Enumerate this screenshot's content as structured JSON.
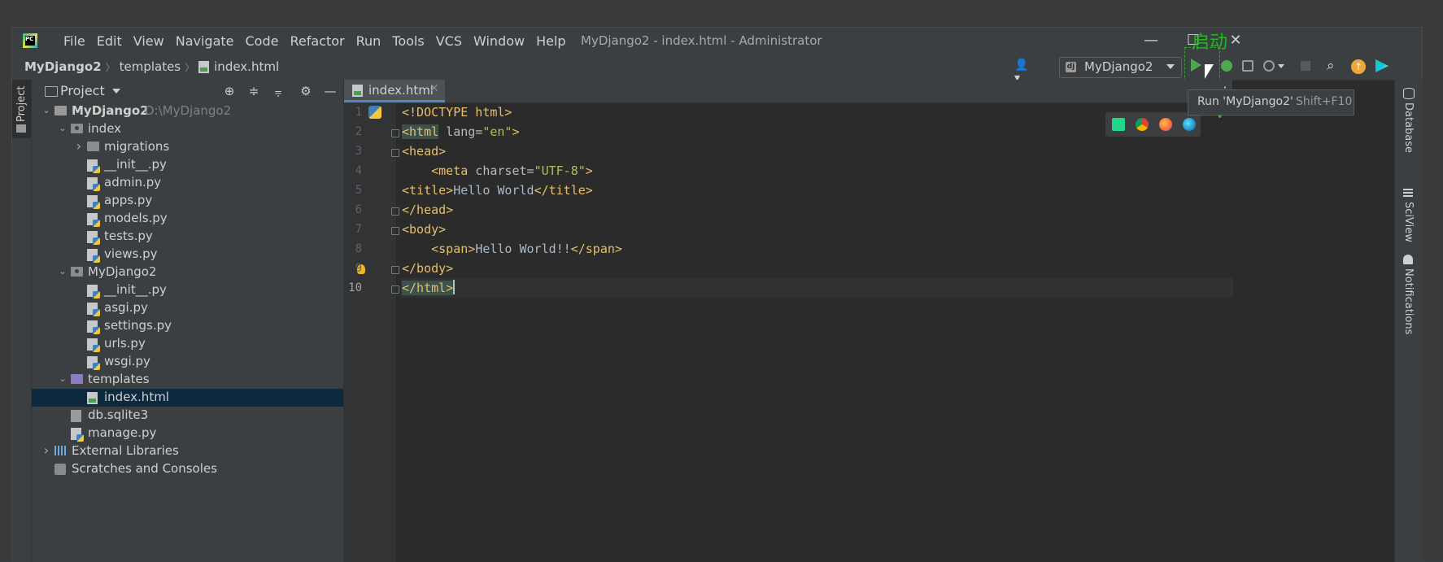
{
  "window": {
    "title": "MyDjango2 - index.html - Administrator",
    "annotation": "启动"
  },
  "menu": [
    "File",
    "Edit",
    "View",
    "Navigate",
    "Code",
    "Refactor",
    "Run",
    "Tools",
    "VCS",
    "Window",
    "Help"
  ],
  "breadcrumb": [
    "MyDjango2",
    "templates",
    "index.html"
  ],
  "toolbar": {
    "run_config": "MyDjango2",
    "tooltip_text": "Run 'MyDjango2'",
    "tooltip_shortcut": "Shift+F10"
  },
  "project_panel": {
    "title": "Project",
    "tree": [
      {
        "label": "MyDjango2",
        "path": "D:\\MyDjango2",
        "depth": 0,
        "type": "root",
        "expanded": true
      },
      {
        "label": "index",
        "depth": 1,
        "type": "module",
        "expanded": true
      },
      {
        "label": "migrations",
        "depth": 2,
        "type": "dir",
        "expanded": false
      },
      {
        "label": "__init__.py",
        "depth": 2,
        "type": "py"
      },
      {
        "label": "admin.py",
        "depth": 2,
        "type": "py"
      },
      {
        "label": "apps.py",
        "depth": 2,
        "type": "py"
      },
      {
        "label": "models.py",
        "depth": 2,
        "type": "py"
      },
      {
        "label": "tests.py",
        "depth": 2,
        "type": "py"
      },
      {
        "label": "views.py",
        "depth": 2,
        "type": "py"
      },
      {
        "label": "MyDjango2",
        "depth": 1,
        "type": "module",
        "expanded": true
      },
      {
        "label": "__init__.py",
        "depth": 2,
        "type": "py"
      },
      {
        "label": "asgi.py",
        "depth": 2,
        "type": "py"
      },
      {
        "label": "settings.py",
        "depth": 2,
        "type": "py"
      },
      {
        "label": "urls.py",
        "depth": 2,
        "type": "py"
      },
      {
        "label": "wsgi.py",
        "depth": 2,
        "type": "py"
      },
      {
        "label": "templates",
        "depth": 1,
        "type": "templates",
        "expanded": true
      },
      {
        "label": "index.html",
        "depth": 2,
        "type": "html",
        "selected": true
      },
      {
        "label": "db.sqlite3",
        "depth": 1,
        "type": "db"
      },
      {
        "label": "manage.py",
        "depth": 1,
        "type": "py"
      },
      {
        "label": "External Libraries",
        "depth": 0,
        "type": "lib",
        "expanded": false
      },
      {
        "label": "Scratches and Consoles",
        "depth": 0,
        "type": "scratch"
      }
    ]
  },
  "editor": {
    "tab": "index.html",
    "current_line": 10,
    "lines": [
      [
        {
          "t": "<!DOCTYPE html>",
          "c": "doc"
        }
      ],
      [
        {
          "t": "<html",
          "c": "tg hl"
        },
        {
          "t": " lang=",
          "c": "at"
        },
        {
          "t": "\"en\"",
          "c": "av"
        },
        {
          "t": ">",
          "c": "tg"
        }
      ],
      [
        {
          "t": "<head>",
          "c": "tg"
        }
      ],
      [
        {
          "t": "    ",
          "c": "tx"
        },
        {
          "t": "<meta",
          "c": "tg"
        },
        {
          "t": " charset=",
          "c": "at"
        },
        {
          "t": "\"UTF-8\"",
          "c": "av"
        },
        {
          "t": ">",
          "c": "tg"
        }
      ],
      [
        {
          "t": "<title>",
          "c": "tg"
        },
        {
          "t": "Hello World",
          "c": "tx"
        },
        {
          "t": "</title>",
          "c": "tg"
        }
      ],
      [
        {
          "t": "</head>",
          "c": "tg"
        }
      ],
      [
        {
          "t": "<body>",
          "c": "tg"
        }
      ],
      [
        {
          "t": "    ",
          "c": "tx"
        },
        {
          "t": "<span>",
          "c": "tg"
        },
        {
          "t": "Hello World!!",
          "c": "tx"
        },
        {
          "t": "</span>",
          "c": "tg"
        }
      ],
      [
        {
          "t": "</body>",
          "c": "tg"
        }
      ],
      [
        {
          "t": "</html>",
          "c": "tg hl"
        }
      ]
    ]
  },
  "right_tools": [
    "Database",
    "SciView",
    "Notifications"
  ],
  "colors": {
    "accent": "#4a88c7",
    "run_green": "#4fa84f",
    "annotation_green": "#22b822",
    "selection": "#0d293e"
  }
}
